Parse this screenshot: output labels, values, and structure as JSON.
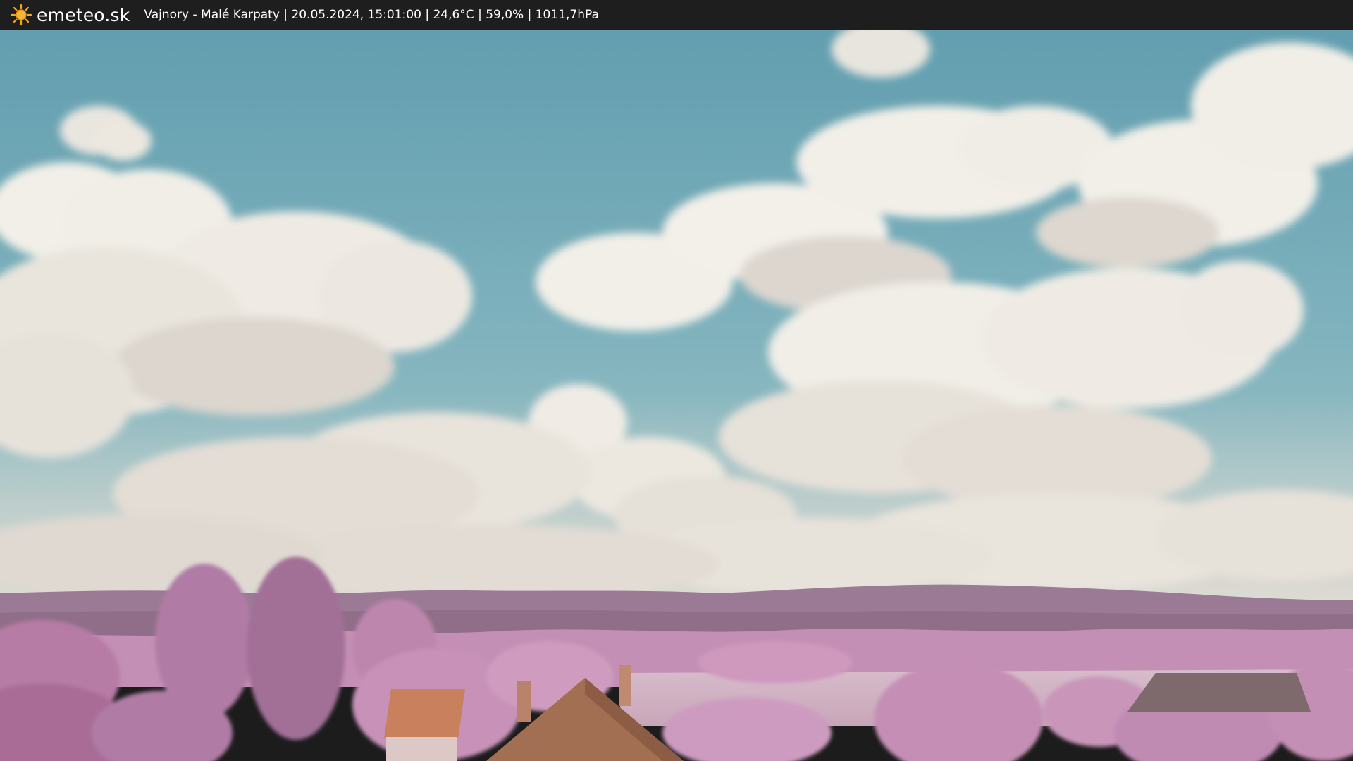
{
  "header": {
    "logo_icon": "sun-icon",
    "brand": "emeteo.sk",
    "caption": "Vajnory - Malé Karpaty | 20.05.2024, 15:01:00 | 24,6°C | 59,0% | 1011,7hPa"
  },
  "colors": {
    "topbar": "#1e1e1e",
    "sky_top": "#5d9bad",
    "sky_bottom": "#9dc3c8",
    "cloud": "#eeebe4",
    "hills": "#9f7e98",
    "foliage": "#c58fb6",
    "field": "#cfb0c2",
    "roof": "#a3704f"
  }
}
